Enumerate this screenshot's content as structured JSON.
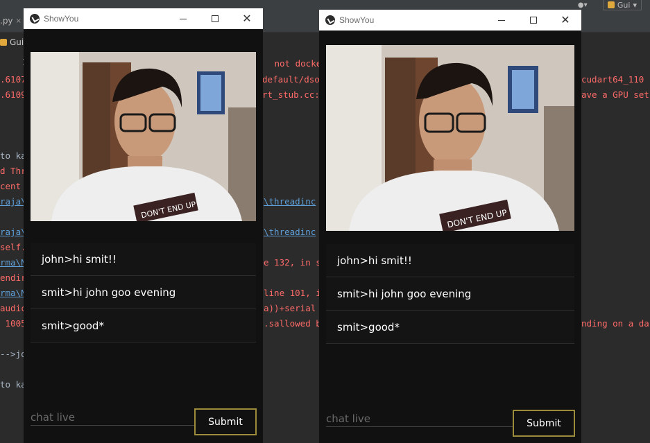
{
  "ide": {
    "run_config_label": "Gui",
    "editor_tab_label": ".py",
    "editor_tab_close": "×",
    "run_tab_label": "Gui",
    "console_lines": [
      {
        "text": "I",
        "cls": "c-gray"
      },
      {
        "text": " not docke",
        "cls": "c-red"
      },
      {
        "text": ".6107",
        "cls": "c-red"
      },
      {
        "text": "default/dso",
        "cls": "c-red"
      },
      {
        "text": "cudart64_110",
        "cls": "c-red"
      },
      {
        "text": ".6109",
        "cls": "c-red"
      },
      {
        "text": "rt_stub.cc:",
        "cls": "c-red"
      },
      {
        "text": "ave a GPU set",
        "cls": "c-red"
      },
      {
        "text": "to ka",
        "cls": "c-gray"
      },
      {
        "text": "d Thr",
        "cls": "c-red"
      },
      {
        "text": "cent",
        "cls": "c-red"
      },
      {
        "text": "raja\\",
        "cls": "c-link"
      },
      {
        "text": "\\threadinc",
        "cls": "c-link"
      },
      {
        "text": "raja\\",
        "cls": "c-link"
      },
      {
        "text": "\\threadinc",
        "cls": "c-link"
      },
      {
        "text": "self.",
        "cls": "c-red"
      },
      {
        "text": "rma\\N",
        "cls": "c-link"
      },
      {
        "text": "e 132, in s",
        "cls": "c-red"
      },
      {
        "text": "endir",
        "cls": "c-red"
      },
      {
        "text": "rma\\N",
        "cls": "c-link"
      },
      {
        "text": "line 101, i",
        "cls": "c-red"
      },
      {
        "text": "audic",
        "cls": "c-red"
      },
      {
        "text": "a))+serial",
        "cls": "c-red"
      },
      {
        "text": " 1005",
        "cls": "c-red"
      },
      {
        "text": ".sallowed b",
        "cls": "c-red"
      },
      {
        "text": "nding on a da",
        "cls": "c-red"
      },
      {
        "text": "-->jo",
        "cls": "c-gray"
      },
      {
        "text": "to ka",
        "cls": "c-gray"
      }
    ]
  },
  "windows": [
    {
      "title": "ShowYou",
      "messages": [
        "john>hi smit!!",
        "smit>hi john goo evening",
        "smit>good*"
      ],
      "input_placeholder": "chat live",
      "input_value": "",
      "submit_label": "Submit"
    },
    {
      "title": "ShowYou",
      "messages": [
        "john>hi smit!!",
        "smit>hi john goo evening",
        "smit>good*"
      ],
      "input_placeholder": "chat live",
      "input_value": "",
      "submit_label": "Submit"
    }
  ],
  "icons": {
    "app": "kivy-logo-icon",
    "minimize": "minimize-icon",
    "maximize": "maximize-icon",
    "close": "close-icon"
  },
  "colors": {
    "window_bg": "#111111",
    "submit_border": "#9b8b3a",
    "console_error": "#ff6b68",
    "console_link": "#5f9fd8"
  }
}
